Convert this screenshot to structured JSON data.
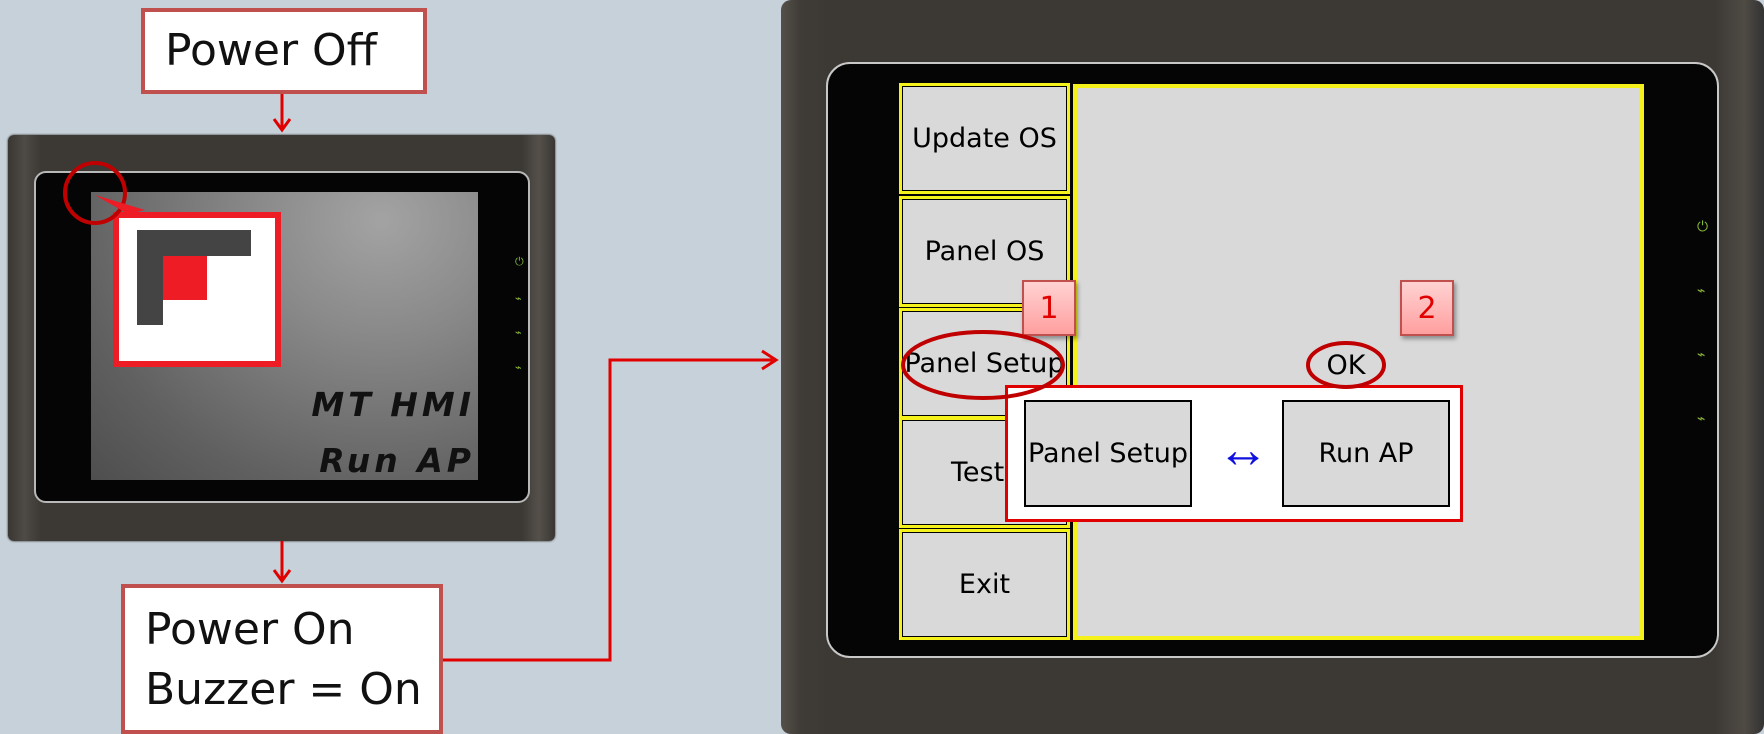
{
  "callouts": {
    "power_off": "Power Off",
    "power_on_line1": "Power On",
    "power_on_line2": "Buzzer = On"
  },
  "small_device": {
    "splash_line1": "MT HMI",
    "splash_line2": "Run AP",
    "leds": [
      "⏻",
      "⌁",
      "⌁",
      "⌁"
    ]
  },
  "large_device": {
    "menu": [
      "Update OS",
      "Panel OS",
      "Panel Setup",
      "Test",
      "Exit"
    ],
    "ok_label": "OK",
    "badges": [
      "1",
      "2"
    ],
    "popup": {
      "left_button": "Panel Setup",
      "right_button": "Run AP",
      "swap_symbol": "↔"
    },
    "leds": [
      "⏻",
      "⌁",
      "⌁",
      "⌁"
    ]
  },
  "colors": {
    "background": "#c7d1d9",
    "callout_border": "#c0504d",
    "highlight_red": "#c00000",
    "screen_frame_yellow": "#f5f11a",
    "swap_arrow_blue": "#1010e0",
    "led_green": "#8ab93a"
  }
}
